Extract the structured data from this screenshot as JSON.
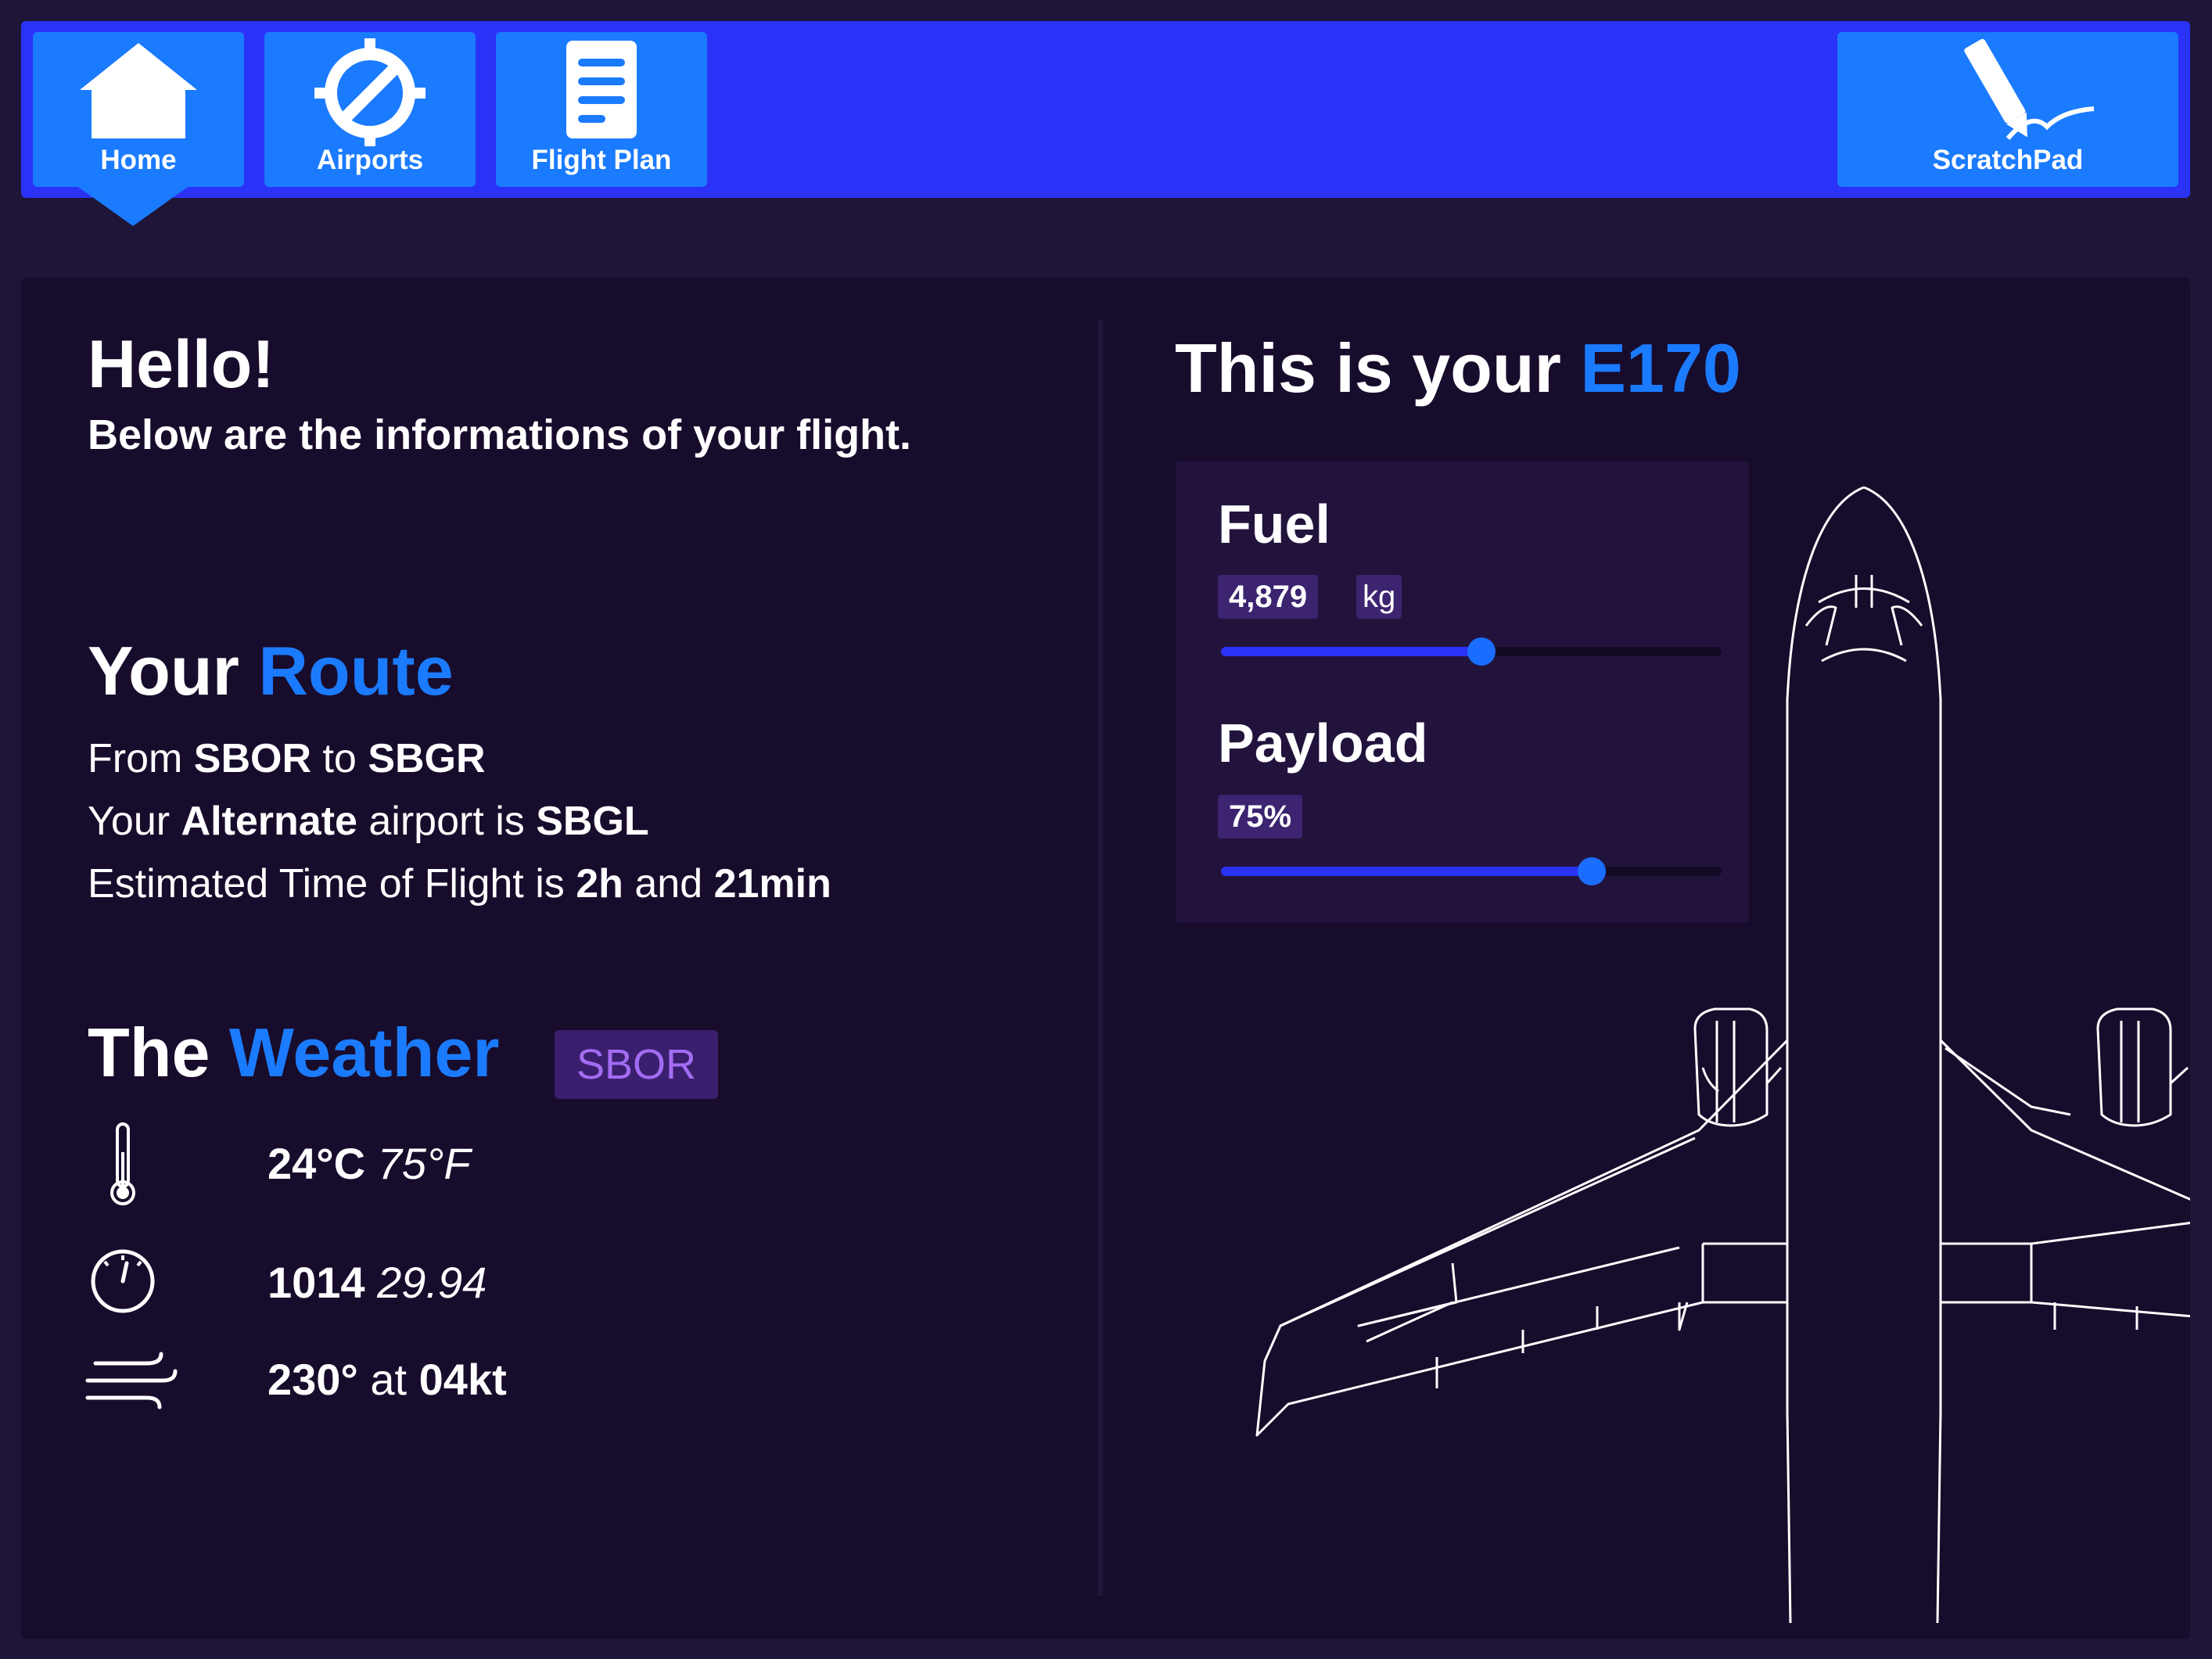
{
  "nav": {
    "home": "Home",
    "airports": "Airports",
    "flight_plan": "Flight Plan",
    "scratchpad": "ScratchPad"
  },
  "greeting": {
    "title": "Hello!",
    "subtitle": "Below are the informations of your flight."
  },
  "route": {
    "title_prefix": "Your",
    "title_accent": "Route",
    "from_label": "From",
    "origin": "SBOR",
    "to_label": "to",
    "destination": "SBGR",
    "alt_prefix": "Your",
    "alt_bold": "Alternate",
    "alt_mid": "airport is",
    "alternate": "SBGL",
    "ete_prefix": "Estimated Time of Flight is",
    "ete_hours": "2h",
    "ete_and": "and",
    "ete_minutes": "21min"
  },
  "weather": {
    "title_prefix": "The",
    "title_accent": "Weather",
    "station": "SBOR",
    "temp_c": "24°C",
    "temp_f": "75°F",
    "pressure_hpa": "1014",
    "pressure_inhg": "29.94",
    "wind_dir": "230°",
    "wind_at": "at",
    "wind_speed": "04kt"
  },
  "aircraft": {
    "title_prefix": "This is your",
    "model": "E170",
    "fuel_label": "Fuel",
    "fuel_value": "4,879",
    "fuel_unit": "kg",
    "fuel_level": 0.52,
    "payload_label": "Payload",
    "payload_value": "75%",
    "payload_level": 0.74
  },
  "colors": {
    "topbar": "#2b32f7",
    "button": "#1b7bff",
    "accent": "#1b7bff",
    "background": "#1f1538",
    "panel": "#180c2c"
  },
  "icons": [
    "home-icon",
    "compass-icon",
    "document-icon",
    "pen-icon",
    "thermometer-icon",
    "gauge-icon",
    "wind-icon",
    "aircraft-outline"
  ]
}
